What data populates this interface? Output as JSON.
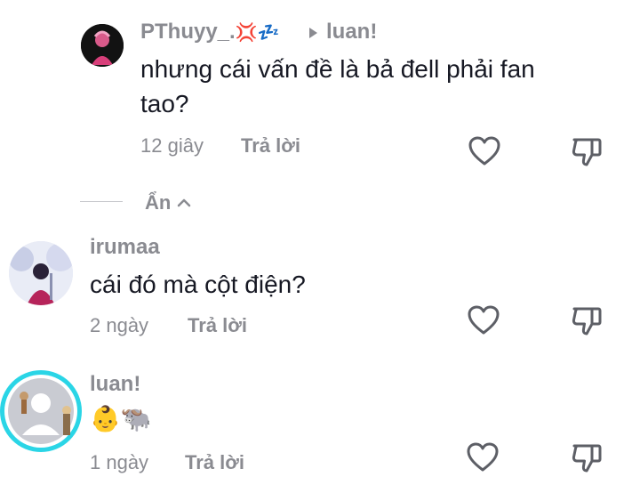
{
  "comments": [
    {
      "username": "PThuyy_.",
      "username_emojis": "💢💤",
      "reply_to": "luan!",
      "text": "nhưng cái vấn đề là bả đell phải fan tao?",
      "time": "12 giây",
      "reply_label": "Trả lời"
    },
    {
      "username": "irumaa",
      "text": "cái đó mà cột điện?",
      "time": "2 ngày",
      "reply_label": "Trả lời"
    },
    {
      "username": "luan!",
      "text": "👶🐃",
      "time": "1 ngày",
      "reply_label": "Trả lời"
    }
  ],
  "hide_replies": {
    "label": "Ẩn"
  },
  "colors": {
    "ring": "#2ad5e6",
    "text": "#161823",
    "muted": "#8a8b91"
  },
  "icons": [
    "heart-icon",
    "dislike-icon",
    "chevron-up-icon",
    "caret-right-icon"
  ]
}
